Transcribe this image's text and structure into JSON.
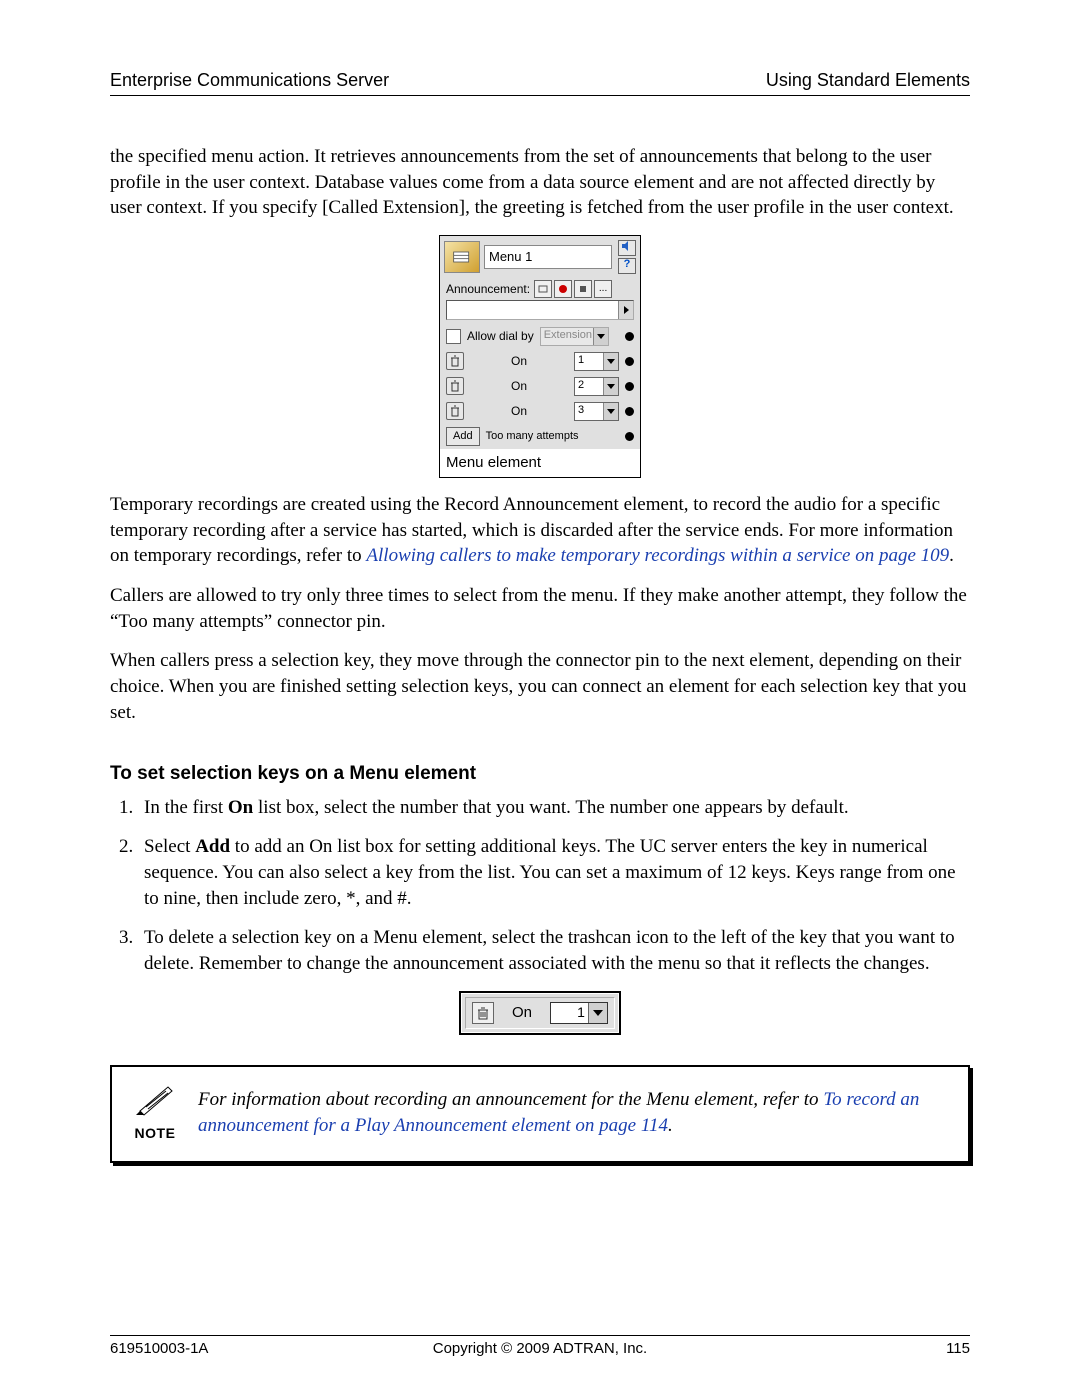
{
  "header": {
    "left": "Enterprise Communications Server",
    "right": "Using Standard Elements"
  },
  "intro_para": "the specified menu action. It retrieves announcements from the set of announcements that belong to the user profile in the user context. Database values come from a data source element and are not affected directly by user context. If you specify [Called Extension], the greeting is fetched from the user profile in the user context.",
  "menu_fig": {
    "title": "Menu 1",
    "help_glyph": "?",
    "announcement_label": "Announcement:",
    "ellipsis": "...",
    "allow_label": "Allow dial by",
    "extension_label": "Extension",
    "on_label": "On",
    "rows": [
      {
        "value": "1"
      },
      {
        "value": "2"
      },
      {
        "value": "3"
      }
    ],
    "add_label": "Add",
    "too_many_label": "Too many attempts",
    "caption": "Menu element"
  },
  "body": {
    "p1a": "Temporary recordings are created using the Record Announcement element, to record the audio for a specific temporary recording after a service has started, which is discarded after the service ends. For more information on temporary recordings, refer to ",
    "p1_link": "Allowing callers to make temporary recordings within a service on page 109",
    "p1b": ".",
    "p2": "Callers are allowed to try only three times to select from the menu. If they make another attempt, they follow the “Too many attempts” connector pin.",
    "p3": "When callers press a selection key, they move through the connector pin to the next element, depending on their choice. When you are finished setting selection keys, you can connect an element for each selection key that you set."
  },
  "heading": "To set selection keys on a Menu element",
  "steps": {
    "s1a": "In the first ",
    "s1b": "On",
    "s1c": " list box, select the number that you want. The number one appears by default.",
    "s2a": "Select ",
    "s2b": "Add",
    "s2c": " to add an On list box for setting additional keys. The UC server enters the key in numerical sequence. You can also select a key from the list. You can set a maximum of 12 keys. Keys range from one to nine, then include zero, *, and #.",
    "s3": "To delete a selection key on a Menu element, select the trashcan icon to the left of the key that you want to delete. Remember to change the announcement associated with the menu so that it reflects the changes."
  },
  "on_fig": {
    "on_label": "On",
    "value": "1"
  },
  "note": {
    "word": "NOTE",
    "text_a": "For information about recording an announcement for the Menu element, refer to ",
    "link": "To record an announcement for a Play Announcement element on page 114",
    "text_b": "."
  },
  "footer": {
    "left": "619510003-1A",
    "center": "Copyright © 2009 ADTRAN, Inc.",
    "right": "115"
  }
}
